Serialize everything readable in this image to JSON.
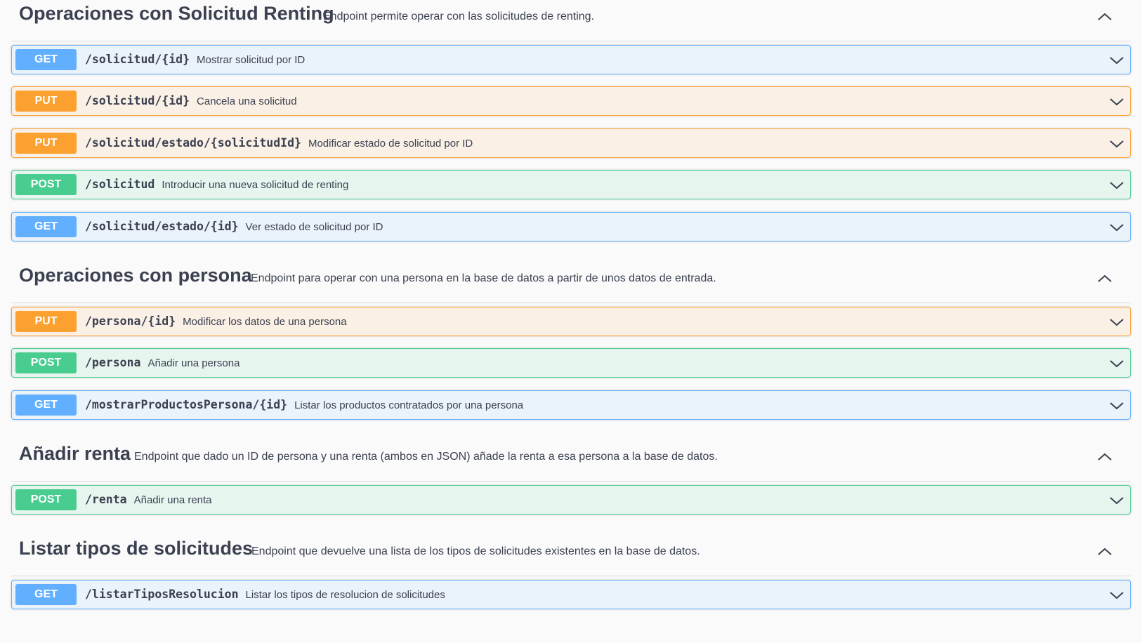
{
  "sections": [
    {
      "title": "Operaciones con Solicitud Renting",
      "description": "Endpoint permite operar con las solicitudes de renting.",
      "ops": [
        {
          "method": "GET",
          "path": "/solicitud/{id}",
          "summary": "Mostrar solicitud por ID"
        },
        {
          "method": "PUT",
          "path": "/solicitud/{id}",
          "summary": "Cancela una solicitud"
        },
        {
          "method": "PUT",
          "path": "/solicitud/estado/{solicitudId}",
          "summary": "Modificar estado de solicitud por ID"
        },
        {
          "method": "POST",
          "path": "/solicitud",
          "summary": "Introducir una nueva solicitud de renting"
        },
        {
          "method": "GET",
          "path": "/solicitud/estado/{id}",
          "summary": "Ver estado de solicitud por ID"
        }
      ]
    },
    {
      "title": "Operaciones con persona",
      "description": "Endpoint para operar con una persona en la base de datos a partir de unos datos de entrada.",
      "ops": [
        {
          "method": "PUT",
          "path": "/persona/{id}",
          "summary": "Modificar los datos de una persona"
        },
        {
          "method": "POST",
          "path": "/persona",
          "summary": "Añadir una persona"
        },
        {
          "method": "GET",
          "path": "/mostrarProductosPersona/{id}",
          "summary": "Listar los productos contratados por una persona"
        }
      ]
    },
    {
      "title": "Añadir renta",
      "description": "Endpoint que dado un ID de persona y una renta (ambos en JSON) añade la renta a esa persona a la base de datos.",
      "ops": [
        {
          "method": "POST",
          "path": "/renta",
          "summary": "Añadir una renta"
        }
      ]
    },
    {
      "title": "Listar tipos de solicitudes",
      "description": "Endpoint que devuelve una lista de los tipos de solicitudes existentes en la base de datos.",
      "ops": [
        {
          "method": "GET",
          "path": "/listarTiposResolucion",
          "summary": "Listar los tipos de resolucion de solicitudes"
        }
      ]
    }
  ],
  "colors": {
    "get": "#61affe",
    "put": "#fca130",
    "post": "#49cc90",
    "text": "#3b4151"
  },
  "icons": {
    "section_toggle": "chevron-up-icon",
    "op_toggle": "chevron-down-icon"
  }
}
